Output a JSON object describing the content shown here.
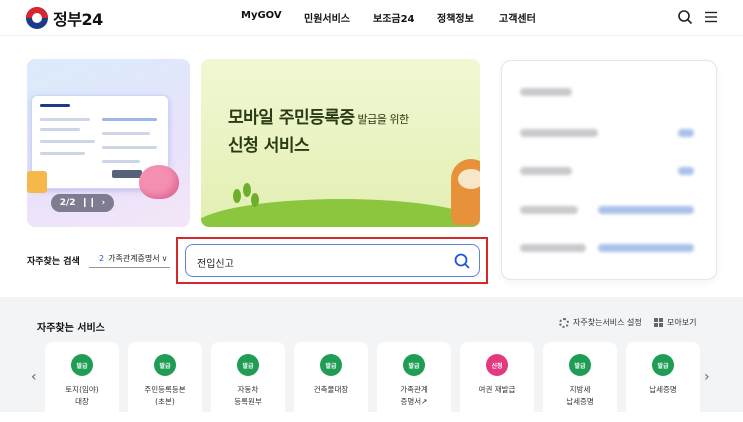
{
  "header": {
    "logo_text": "정부24",
    "nav": [
      "MyGOV",
      "민원서비스",
      "보조금24",
      "정책정보",
      "고객센터"
    ],
    "icons": [
      "search-icon",
      "menu-icon"
    ]
  },
  "banner_left": {
    "pager": "2/2"
  },
  "banner_main": {
    "title_main": "모바일 주민등록증",
    "title_small": " 발급을 위한",
    "title_line2": "신청 서비스"
  },
  "frequent_search": {
    "label": "자주찾는 검색",
    "select_number": "2",
    "select_value": "가족관계증명서"
  },
  "search": {
    "value": "전입신고"
  },
  "services": {
    "title": "자주찾는 서비스",
    "setting_label": "자주찾는서비스 설정",
    "collect_label": "모아보기",
    "items": [
      {
        "badge": "발급",
        "label": "토지(임야)\n대장",
        "color": "#1f9d55"
      },
      {
        "badge": "발급",
        "label": "주민등록등본\n(초본)",
        "color": "#1f9d55"
      },
      {
        "badge": "발급",
        "label": "자동차\n등록원부",
        "color": "#1f9d55"
      },
      {
        "badge": "발급",
        "label": "건축물대장",
        "color": "#1f9d55"
      },
      {
        "badge": "발급",
        "label": "가족관계\n증명서↗",
        "color": "#1f9d55"
      },
      {
        "badge": "신청",
        "label": "여권 재발급",
        "color": "#e5397f"
      },
      {
        "badge": "발급",
        "label": "지방세\n납세증명",
        "color": "#1f9d55"
      },
      {
        "badge": "발급",
        "label": "납세증명",
        "color": "#1f9d55"
      }
    ]
  }
}
